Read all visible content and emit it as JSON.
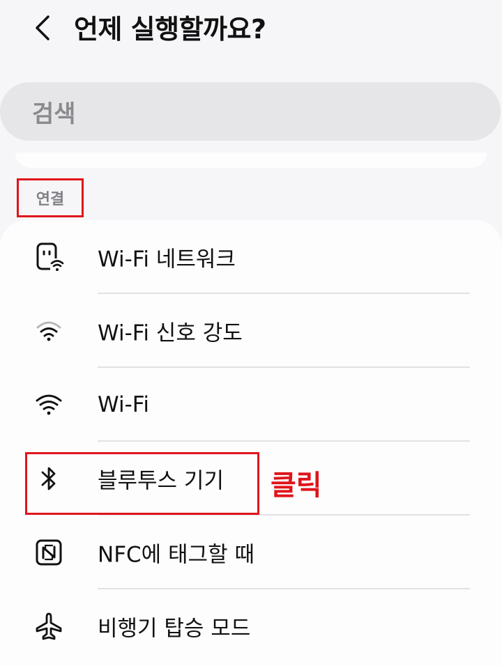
{
  "header": {
    "title": "언제 실행할까요?"
  },
  "search": {
    "placeholder": "검색"
  },
  "section": {
    "label": "연결"
  },
  "items": [
    {
      "label": "Wi-Fi 네트워크",
      "icon": "wifi-network-icon"
    },
    {
      "label": "Wi-Fi 신호 강도",
      "icon": "wifi-signal-icon"
    },
    {
      "label": "Wi-Fi",
      "icon": "wifi-icon"
    },
    {
      "label": "블루투스 기기",
      "icon": "bluetooth-icon"
    },
    {
      "label": "NFC에 태그할 때",
      "icon": "nfc-icon"
    },
    {
      "label": "비행기 탑승 모드",
      "icon": "airplane-icon"
    }
  ],
  "annotation": {
    "text": "클릭",
    "color": "#e0141b"
  },
  "colors": {
    "background": "#f6f6f8",
    "card": "#fdfdfe",
    "search_bg": "#e6e6e9",
    "highlight": "#e0141b"
  }
}
